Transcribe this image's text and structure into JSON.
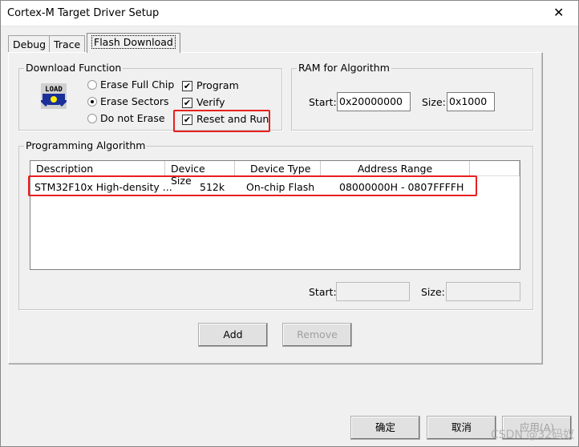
{
  "window": {
    "title": "Cortex-M Target Driver Setup",
    "close_icon": "close-icon"
  },
  "tabs": [
    {
      "label": "Debug"
    },
    {
      "label": "Trace"
    },
    {
      "label": "Flash Download",
      "active": true
    }
  ],
  "download_function": {
    "title": "Download Function",
    "icon_text": "LOAD",
    "erase_options": [
      {
        "label": "Erase Full Chip",
        "selected": false
      },
      {
        "label": "Erase Sectors",
        "selected": true
      },
      {
        "label": "Do not Erase",
        "selected": false
      }
    ],
    "checks": [
      {
        "label": "Program",
        "checked": true
      },
      {
        "label": "Verify",
        "checked": true
      },
      {
        "label": "Reset and Run",
        "checked": true
      }
    ]
  },
  "ram": {
    "title": "RAM for Algorithm",
    "start_label": "Start:",
    "start": "0x20000000",
    "size_label": "Size:",
    "size": "0x1000"
  },
  "algorithm": {
    "title": "Programming Algorithm",
    "columns": [
      "Description",
      "Device Size",
      "Device Type",
      "Address Range"
    ],
    "rows": [
      {
        "description": "STM32F10x High-density ...",
        "size": "512k",
        "type": "On-chip Flash",
        "range": "08000000H - 0807FFFFH"
      }
    ],
    "start_label": "Start:",
    "start": "",
    "size_label": "Size:",
    "size": ""
  },
  "buttons": {
    "add": "Add",
    "remove": "Remove",
    "ok": "确定",
    "cancel": "取消",
    "apply": "应用(A)"
  },
  "watermark": "CSDN @32码奴",
  "highlight_color": "#e8201e"
}
